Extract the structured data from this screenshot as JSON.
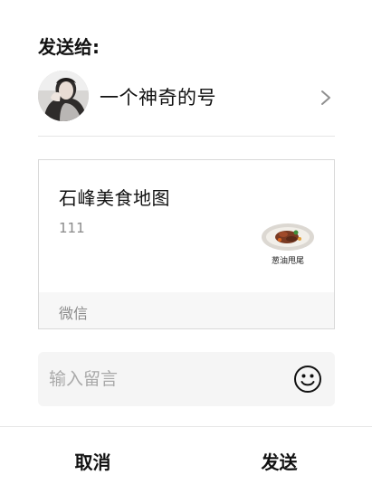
{
  "dialog": {
    "title": "发送给:",
    "recipient": {
      "name": "一个神奇的号",
      "avatar_icon": "person-avatar",
      "chevron_icon": "chevron-right-icon"
    },
    "card": {
      "title": "石峰美食地图",
      "description": "111",
      "thumb_icon": "food-dish-thumbnail",
      "thumb_caption": "葱油甩尾",
      "source": "微信"
    },
    "message": {
      "value": "",
      "placeholder": "输入留言",
      "emoji_icon": "smiley-face-icon"
    },
    "actions": {
      "cancel_label": "取消",
      "send_label": "发送"
    }
  }
}
